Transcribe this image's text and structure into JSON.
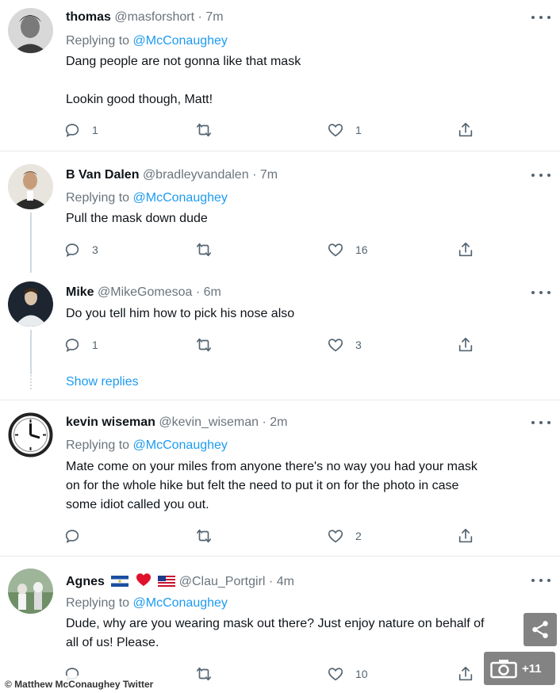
{
  "tweets": [
    {
      "name": "thomas",
      "handle": "@masforshort",
      "time": "7m",
      "replying_prefix": "Replying to",
      "replying_to": "@McConaughey",
      "text": "Dang people are not gonna like that mask\n\nLookin good though, Matt!",
      "reply_count": "1",
      "retweet_count": "",
      "like_count": "1"
    },
    {
      "name": "B Van Dalen",
      "handle": "@bradleyvandalen",
      "time": "7m",
      "replying_prefix": "Replying to",
      "replying_to": "@McConaughey",
      "text": "Pull the mask down dude",
      "reply_count": "3",
      "retweet_count": "",
      "like_count": "16"
    },
    {
      "name": "Mike",
      "handle": "@MikeGomesoa",
      "time": "6m",
      "text": "Do you tell him how to pick his nose also",
      "reply_count": "1",
      "retweet_count": "",
      "like_count": "3"
    },
    {
      "name": "kevin wiseman",
      "handle": "@kevin_wiseman",
      "time": "2m",
      "replying_prefix": "Replying to",
      "replying_to": "@McConaughey",
      "text": "Mate come on your miles from anyone there's no way you had your mask\non for the whole hike but felt the need to put it on for the photo in case\nsome idiot called you out.",
      "reply_count": "",
      "retweet_count": "",
      "like_count": "2"
    },
    {
      "name": "Agnes",
      "handle": "@Clau_Portgirl",
      "time": "4m",
      "replying_prefix": "Replying to",
      "replying_to": "@McConaughey",
      "text": "Dude, why are you wearing mask out there? Just enjoy nature on behalf of\nall of us! Please.",
      "reply_count": "",
      "retweet_count": "",
      "like_count": "10"
    }
  ],
  "show_replies": "Show replies",
  "separator": "·",
  "credit": "© Matthew McConaughey Twitter",
  "gallery_count": "+11",
  "colors": {
    "link": "#1d9bf0",
    "muted": "#6b747c",
    "icon": "#536471",
    "divider": "#e7e9eb"
  },
  "icons": [
    "reply-icon",
    "retweet-icon",
    "like-icon",
    "share-icon",
    "more-icon",
    "camera-icon"
  ]
}
